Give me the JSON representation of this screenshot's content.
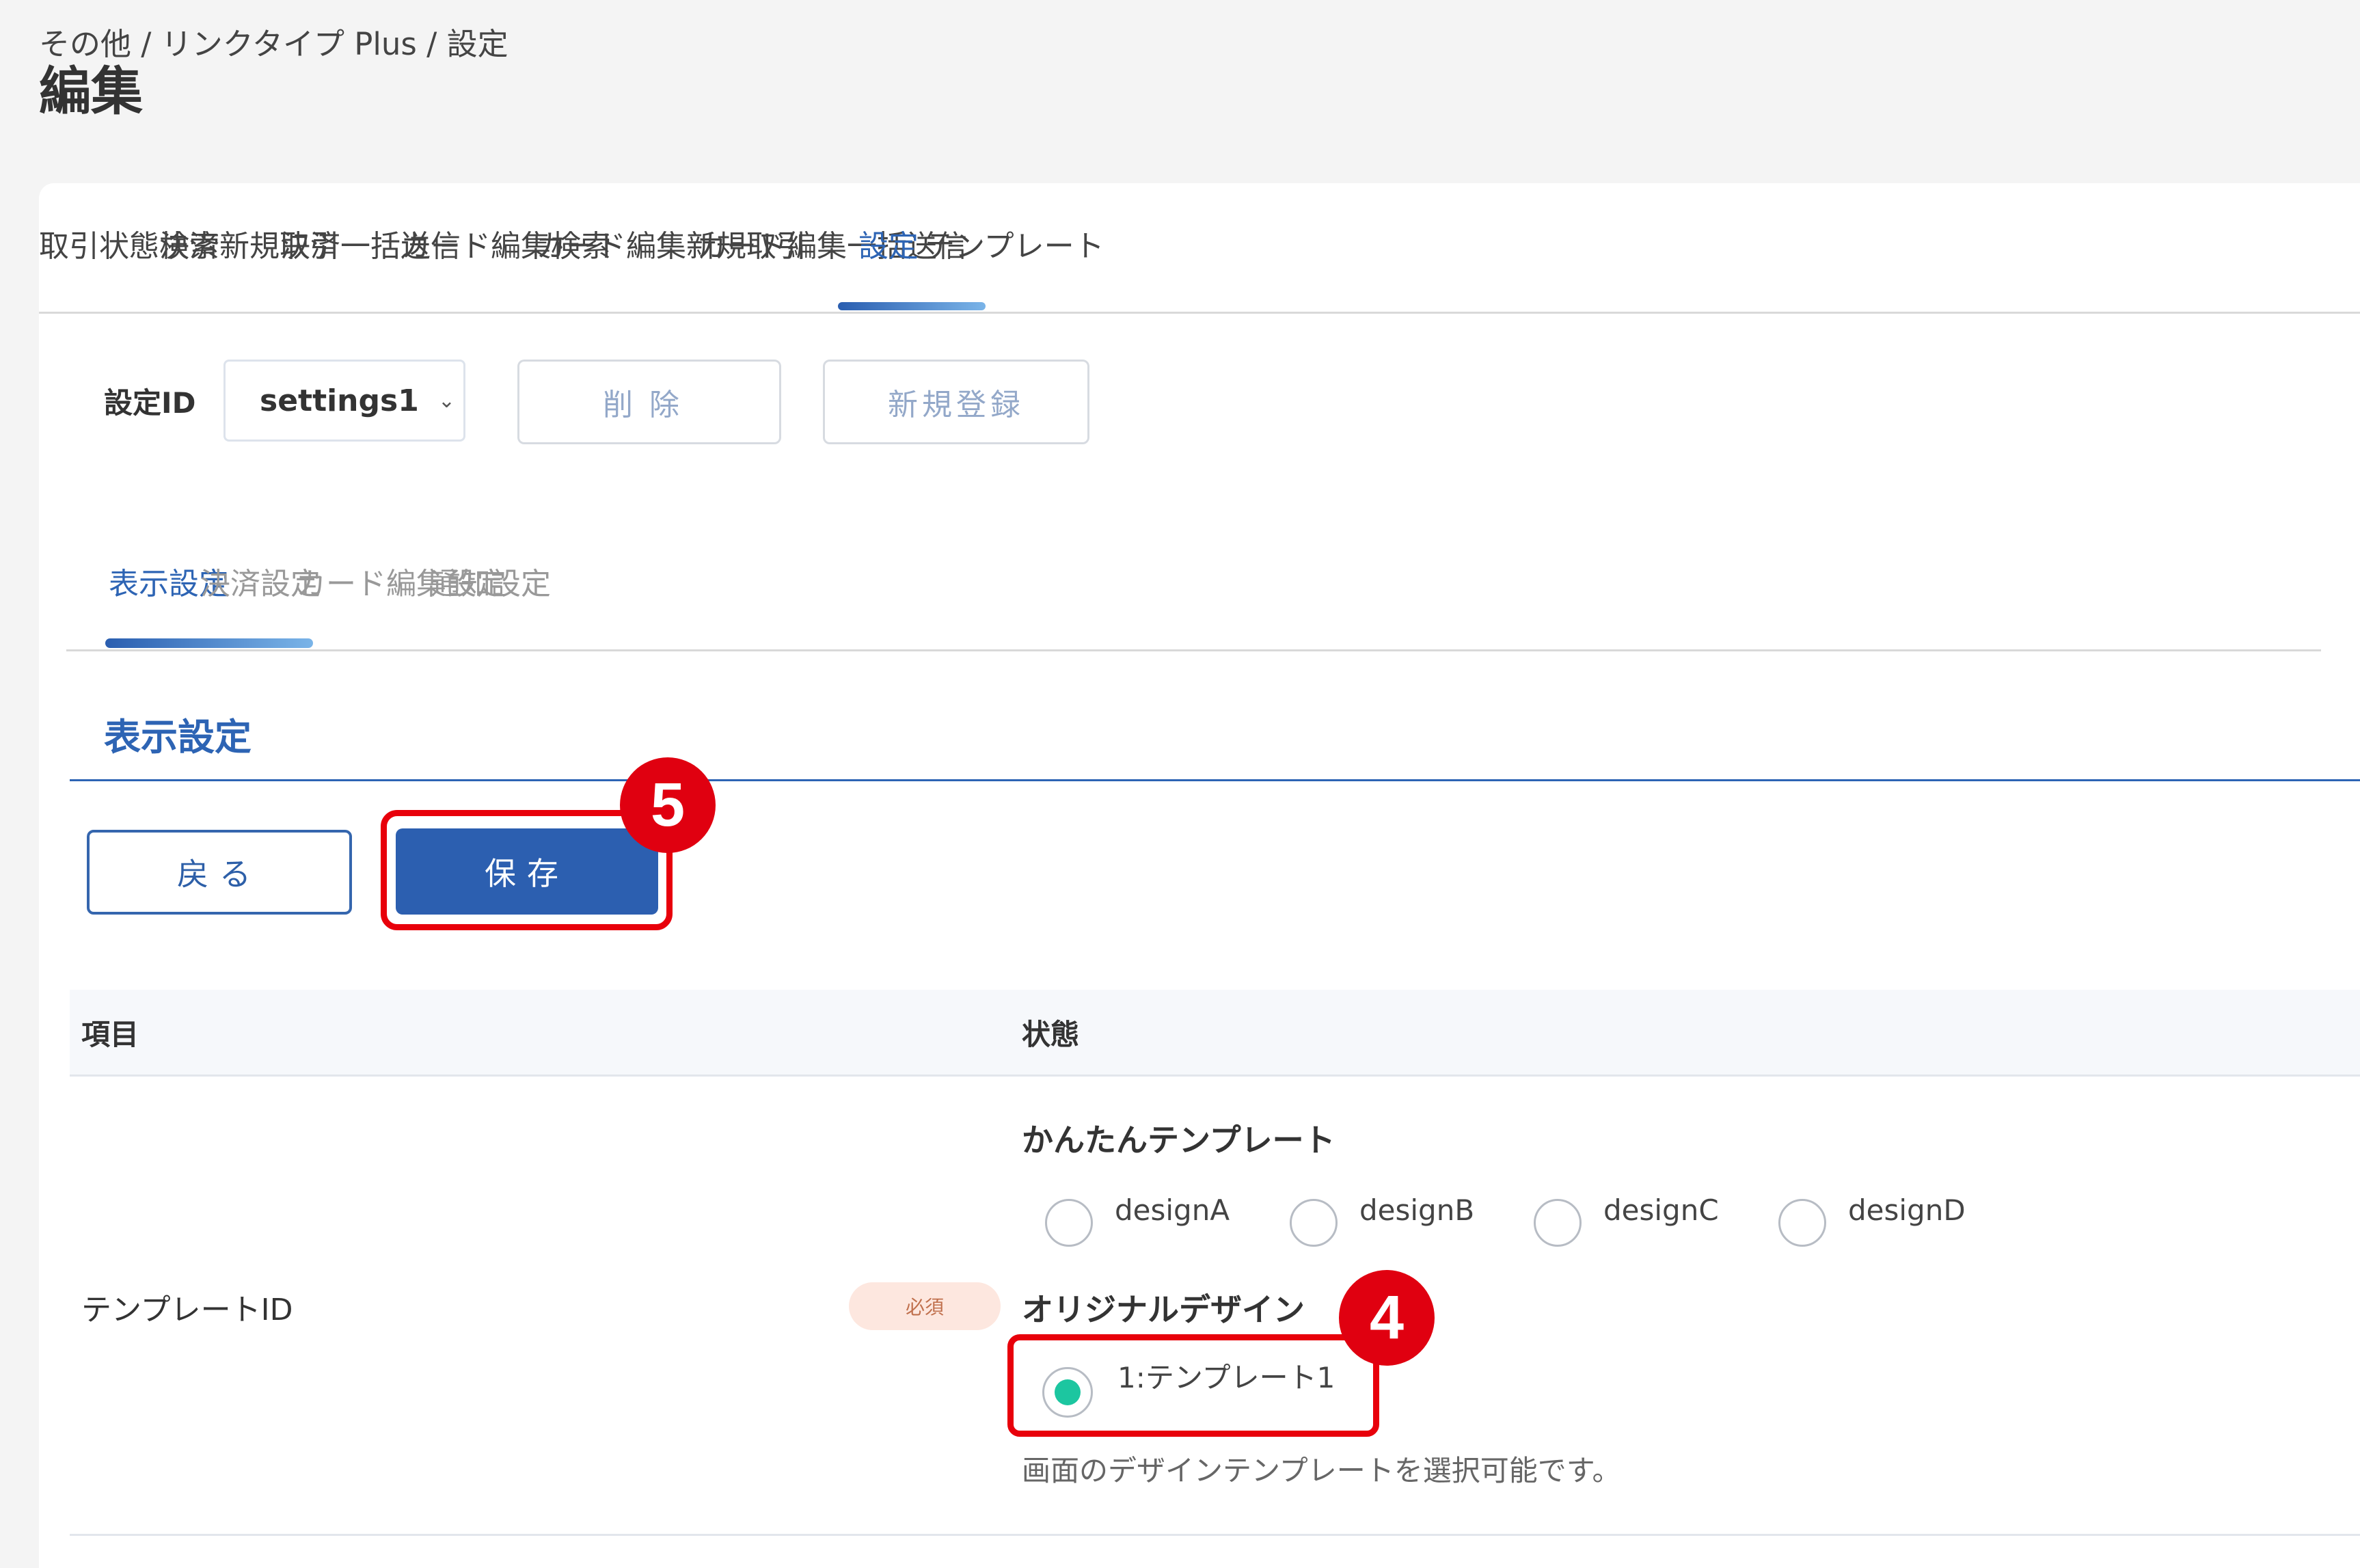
{
  "breadcrumb": "その他 / リンクタイプ Plus / 設定",
  "page_title": "編集",
  "top_tabs": [
    {
      "label": "取引状態検索"
    },
    {
      "label": "決済新規取引"
    },
    {
      "label": "決済一括送信"
    },
    {
      "label": "カード編集検索"
    },
    {
      "label": "カード編集新規取引"
    },
    {
      "label": "カード編集一括送信"
    },
    {
      "label": "設定",
      "active": true
    },
    {
      "label": "テンプレート"
    }
  ],
  "settings": {
    "id_label": "設定ID",
    "selected_id": "settings1",
    "delete_label": "削除",
    "new_register_label": "新規登録"
  },
  "sub_tabs": [
    {
      "label": "表示設定",
      "active": true
    },
    {
      "label": "決済設定"
    },
    {
      "label": "カード編集設定"
    },
    {
      "label": "通知設定"
    }
  ],
  "section": {
    "title": "表示設定",
    "back_label": "戻る",
    "save_label": "保存"
  },
  "steps": {
    "save_step": "5",
    "template_step": "4"
  },
  "table": {
    "headers": [
      "項目",
      "状態"
    ],
    "row": {
      "label": "テンプレートID",
      "required": "必須",
      "simple_heading": "かんたんテンプレート",
      "simple_options": [
        "designA",
        "designB",
        "designC",
        "designD"
      ],
      "original_heading": "オリジナルデザイン",
      "original_option": "1:テンプレート1",
      "original_selected": true,
      "help": "画面のデザインテンプレートを選択可能です。"
    }
  },
  "colors": {
    "accent": "#2c5fb0",
    "highlight": "#e8000b",
    "radio_selected": "#1cc6a0"
  }
}
